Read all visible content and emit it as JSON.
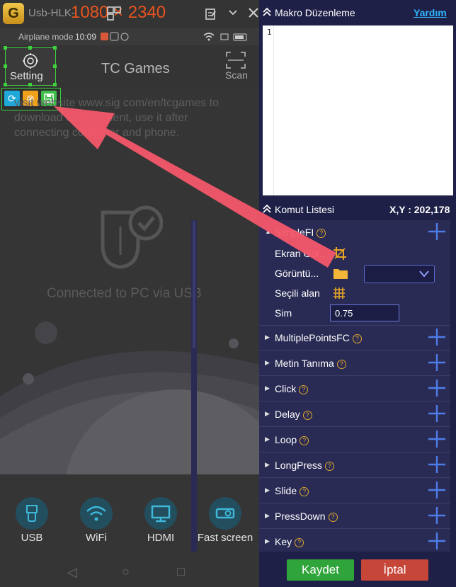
{
  "window": {
    "device_name": "Usb-HLK-",
    "resolution": "1080 × 2340"
  },
  "phone": {
    "status_left": "Airplane mode",
    "status_time": "10:09",
    "app_title": "TC Games",
    "scan_label": "Scan",
    "setting_label": "Setting",
    "info_text": "visit website www.sig com/en/tcgames to download es PC Client, use it after connecting computer and phone.",
    "connected_text": "Connected to PC via USB",
    "dock": [
      {
        "label": "USB",
        "icon": "usb-icon"
      },
      {
        "label": "WiFi",
        "icon": "wifi-icon"
      },
      {
        "label": "HDMI",
        "icon": "monitor-icon"
      },
      {
        "label": "Fast screen",
        "icon": "projector-icon"
      }
    ],
    "colors": {
      "resolution": "#e8541e",
      "selection": "#3fd23f",
      "dock": "#234e5e"
    }
  },
  "macro": {
    "title": "Makro Düzenleme",
    "help": "Yardım",
    "line_number": "1",
    "command_list_title": "Komut Listesi",
    "coords": "X,Y : 202,178",
    "expanded": {
      "name": "SimpleFI",
      "rows": [
        {
          "label": "Ekran Gör...",
          "icon": "crop-icon"
        },
        {
          "label": "Görüntü...",
          "icon": "folder-icon"
        },
        {
          "label": "Seçili alan",
          "icon": "grid-icon"
        },
        {
          "label": "Sim",
          "value": "0.75"
        }
      ]
    },
    "commands": [
      "MultiplePointsFC",
      "Metin Tanıma",
      "Click",
      "Delay",
      "Loop",
      "LongPress",
      "Slide",
      "PressDown",
      "Key"
    ],
    "save_label": "Kaydet",
    "cancel_label": "İptal",
    "colors": {
      "panel": "#1f2048",
      "list": "#2a2b55",
      "save": "#2ea43a",
      "cancel": "#c6463a",
      "plus": "#4d7de8",
      "link": "#2fb6ff"
    }
  }
}
